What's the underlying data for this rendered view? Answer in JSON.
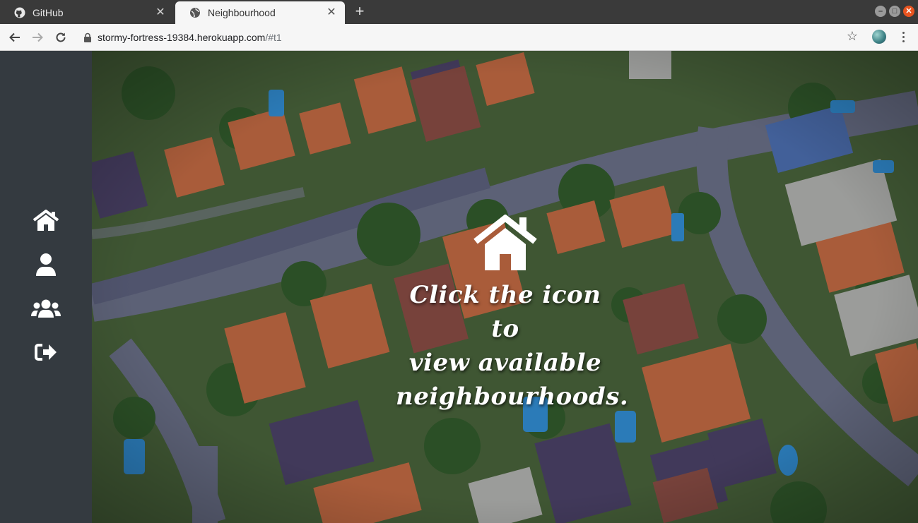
{
  "browser": {
    "tabs": [
      {
        "title": "GitHub",
        "icon": "github-icon",
        "active": false
      },
      {
        "title": "Neighbourhood",
        "icon": "globe-icon",
        "active": true
      }
    ],
    "address": {
      "host": "stormy-fortress-19384.herokuapp.com",
      "path": "/#t1"
    }
  },
  "sidebar": {
    "items": [
      {
        "name": "home",
        "icon": "home-icon"
      },
      {
        "name": "profile",
        "icon": "user-icon"
      },
      {
        "name": "neighbours",
        "icon": "users-icon"
      },
      {
        "name": "logout",
        "icon": "sign-out-icon"
      }
    ]
  },
  "hero": {
    "message_lines": [
      "Click the icon to",
      "view available",
      "neighbourhoods."
    ]
  },
  "colors": {
    "sidebar": "#343a40",
    "tab_bar": "#3a3a3a",
    "toolbar": "#f6f6f6",
    "close_button": "#e95420"
  }
}
